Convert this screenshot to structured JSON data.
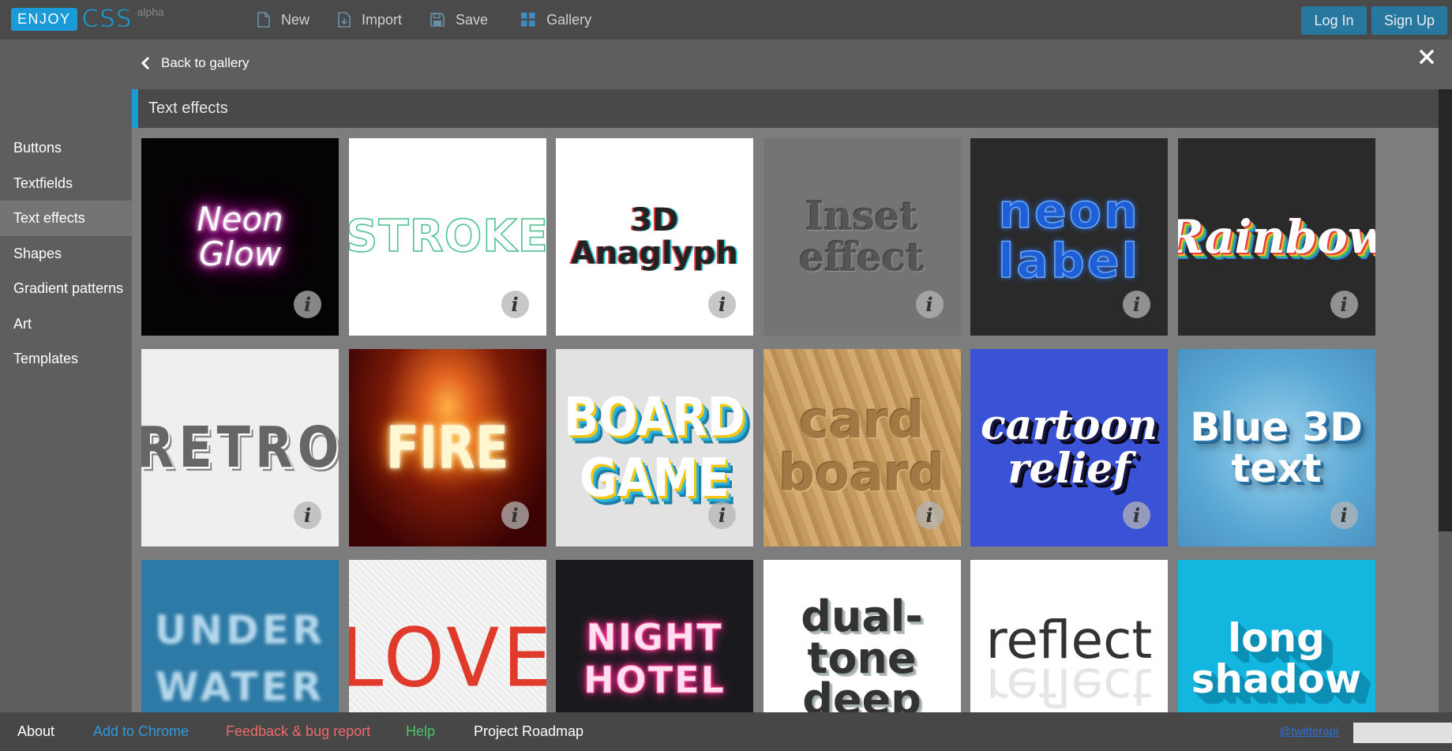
{
  "app": {
    "logo_enjoy": "ENJOY",
    "logo_css": "CSS",
    "logo_tag": "alpha"
  },
  "topnav": {
    "new": "New",
    "import": "Import",
    "save": "Save",
    "gallery": "Gallery"
  },
  "auth": {
    "login": "Log In",
    "signup": "Sign Up"
  },
  "back_label": "Back to gallery",
  "sidebar": {
    "items": [
      {
        "label": "Buttons",
        "active": false
      },
      {
        "label": "Textfields",
        "active": false
      },
      {
        "label": "Text effects",
        "active": true
      },
      {
        "label": "Shapes",
        "active": false
      },
      {
        "label": "Gradient patterns",
        "active": false
      },
      {
        "label": "Art",
        "active": false
      },
      {
        "label": "Templates",
        "active": false
      }
    ]
  },
  "section": {
    "title": "Text effects"
  },
  "tiles": [
    {
      "lines": [
        "Neon",
        "Glow"
      ],
      "icon": "info-icon"
    },
    {
      "lines": [
        "STROKE"
      ],
      "icon": "info-icon"
    },
    {
      "lines": [
        "3D",
        "Anaglyph"
      ],
      "icon": "info-icon"
    },
    {
      "lines": [
        "Inset",
        "effect"
      ],
      "icon": "info-icon"
    },
    {
      "lines": [
        "neon",
        "label"
      ],
      "icon": "info-icon"
    },
    {
      "lines": [
        "Rainbow"
      ],
      "icon": "info-icon"
    },
    {
      "lines": [
        "RETRO"
      ],
      "icon": "info-icon"
    },
    {
      "lines": [
        "FIRE"
      ],
      "icon": "info-icon"
    },
    {
      "lines": [
        "BOARD",
        "GAME"
      ],
      "icon": "info-icon"
    },
    {
      "lines": [
        "card",
        "board"
      ],
      "icon": "info-icon"
    },
    {
      "lines": [
        "cartoon",
        "relief"
      ],
      "icon": "info-icon"
    },
    {
      "lines": [
        "Blue 3D",
        "text"
      ],
      "icon": "info-icon"
    },
    {
      "lines": [
        "UNDER",
        "WATER"
      ],
      "icon": "info-icon"
    },
    {
      "lines": [
        "LOVE"
      ],
      "icon": "info-icon"
    },
    {
      "lines": [
        "NIGHT",
        "HOTEL"
      ],
      "icon": "info-icon"
    },
    {
      "lines": [
        "dual-",
        "tone",
        "deep"
      ],
      "icon": "info-icon"
    },
    {
      "lines": [
        "reflect"
      ],
      "icon": "info-icon"
    },
    {
      "lines": [
        "long",
        "shadow"
      ],
      "icon": "info-icon"
    }
  ],
  "info_glyph": "i",
  "footer": {
    "about": "About",
    "add_to_chrome": "Add to Chrome",
    "feedback": "Feedback & bug report",
    "help": "Help",
    "roadmap": "Project Roadmap",
    "twitter": "@twitterapi"
  },
  "colors": {
    "accent": "#1a9ad6",
    "auth_button": "#28779f",
    "footer_add_to_chrome": "#2f9ae0",
    "footer_feedback": "#ec6a6a",
    "footer_help": "#4cc46a",
    "footer_about": "#ffffff",
    "footer_roadmap": "#ffffff"
  }
}
